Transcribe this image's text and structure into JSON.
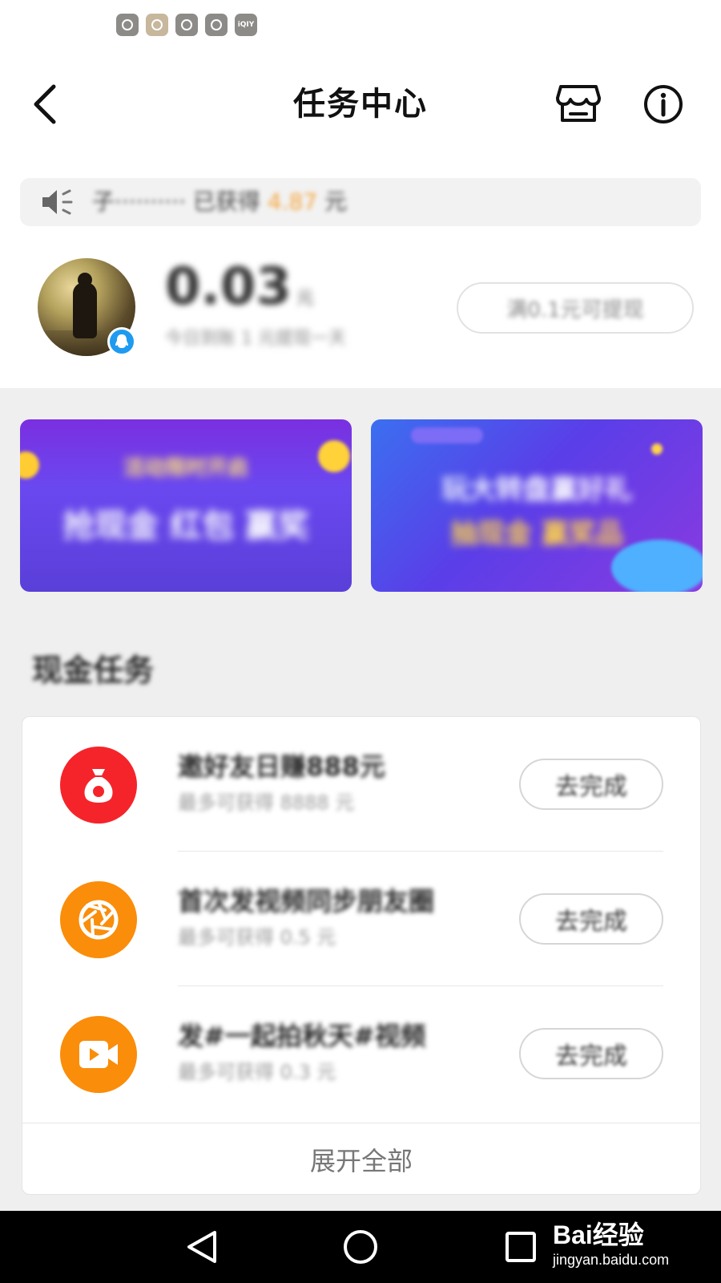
{
  "header": {
    "title": "任务中心"
  },
  "notice": {
    "prefix": "子··········",
    "middle": " 已获得 ",
    "amount": "4.87",
    "suffix": " 元"
  },
  "account": {
    "balance": "0.03",
    "balance_unit": "元",
    "balance_sub": "今日到账 1 元提现一天",
    "withdraw_label": "满0.1元可提现"
  },
  "banners": [
    {
      "line1": "活动限时开启",
      "line2": "抢现金 红包 赢奖"
    },
    {
      "line1": "玩大转盘赢好礼",
      "line2": "抽现金 赢奖品"
    }
  ],
  "section": {
    "title": "现金任务"
  },
  "tasks": [
    {
      "name": "邀好友日赚888元",
      "reward": "最多可获得 8888 元",
      "button": "去完成",
      "icon": "money-bag-icon",
      "color": "#f5242a"
    },
    {
      "name": "首次发视频同步朋友圈",
      "reward": "最多可获得 0.5 元",
      "button": "去完成",
      "icon": "aperture-icon",
      "color": "#fa8d0a"
    },
    {
      "name": "发#一起拍秋天#视频",
      "reward": "最多可获得 0.3 元",
      "button": "去完成",
      "icon": "video-camera-icon",
      "color": "#fa8d0a"
    }
  ],
  "expand_label": "展开全部",
  "watermark": {
    "logo": "Bai经验",
    "url": "jingyan.baidu.com"
  }
}
